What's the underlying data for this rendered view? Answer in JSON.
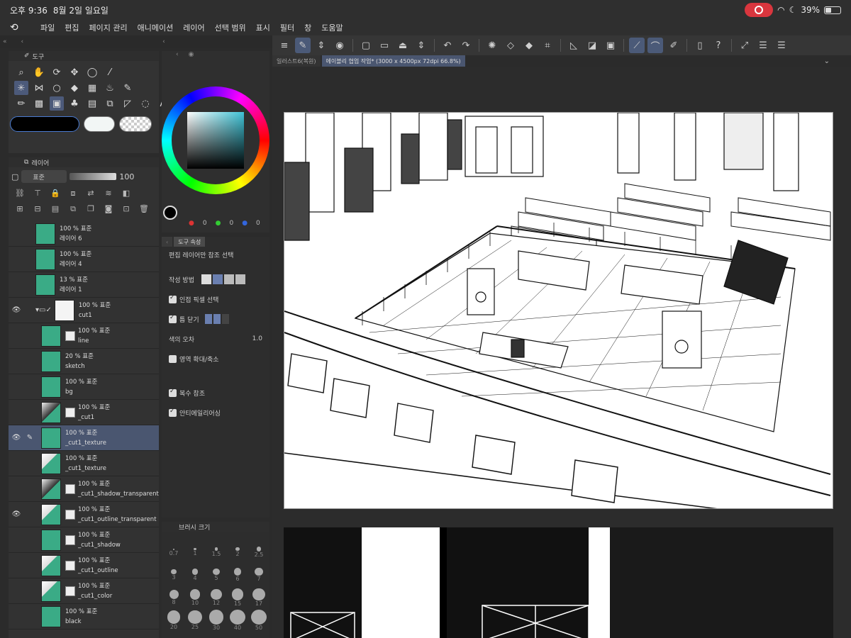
{
  "status_bar": {
    "time": "오후 9:36",
    "date": "8월 2일 일요일",
    "battery": "39%"
  },
  "menu": [
    "파일",
    "편집",
    "페이지 관리",
    "애니메이션",
    "레이어",
    "선택 범위",
    "표시",
    "필터",
    "창",
    "도움말"
  ],
  "tabs": [
    {
      "label": "일러스트6(복원)"
    },
    {
      "label": "에이블리 협업 작업* (3000 x 4500px 72dpi 66.8%)"
    }
  ],
  "tool_panel": {
    "title": "도구"
  },
  "layer_panel": {
    "title": "레이어",
    "blend_mode": "표준",
    "opacity": "100"
  },
  "layers": [
    {
      "opacity": "100 % 표준",
      "name": "레이어 6",
      "eye": "",
      "pen": "",
      "thumb": "green",
      "mask": false,
      "indent": false,
      "selected": false
    },
    {
      "opacity": "100 % 표준",
      "name": "레이어 4",
      "eye": "",
      "pen": "",
      "thumb": "green",
      "mask": false,
      "indent": false,
      "selected": false
    },
    {
      "opacity": "13 % 표준",
      "name": "레이어 1",
      "eye": "",
      "pen": "",
      "thumb": "green",
      "mask": false,
      "indent": false,
      "selected": false
    },
    {
      "opacity": "100 % 표준",
      "name": "cut1",
      "eye": "👁",
      "pen": "",
      "thumb": "white",
      "mask": false,
      "indent": false,
      "selected": false,
      "folder": true
    },
    {
      "opacity": "100 % 표준",
      "name": "line",
      "eye": "",
      "pen": "",
      "thumb": "green",
      "mask": true,
      "indent": true,
      "selected": false
    },
    {
      "opacity": "20 % 표준",
      "name": "sketch",
      "eye": "",
      "pen": "",
      "thumb": "green",
      "mask": false,
      "indent": true,
      "selected": false
    },
    {
      "opacity": "100 % 표준",
      "name": "bg",
      "eye": "",
      "pen": "",
      "thumb": "green",
      "mask": false,
      "indent": true,
      "selected": false
    },
    {
      "opacity": "100 % 표준",
      "name": "_cut1",
      "eye": "",
      "pen": "",
      "thumb": "dark",
      "mask": true,
      "indent": true,
      "selected": false
    },
    {
      "opacity": "100 % 표준",
      "name": "_cut1_texture",
      "eye": "👁",
      "pen": "✎",
      "thumb": "green",
      "mask": false,
      "indent": true,
      "selected": true
    },
    {
      "opacity": "100 % 표준",
      "name": "_cut1_texture",
      "eye": "",
      "pen": "",
      "thumb": "sketch",
      "mask": false,
      "indent": true,
      "selected": false
    },
    {
      "opacity": "100 % 표준",
      "name": "_cut1_shadow_transparent",
      "eye": "",
      "pen": "",
      "thumb": "dark",
      "mask": true,
      "indent": true,
      "selected": false
    },
    {
      "opacity": "100 % 표준",
      "name": "_cut1_outline_transparent",
      "eye": "👁",
      "pen": "",
      "thumb": "sketch",
      "mask": true,
      "indent": true,
      "selected": false
    },
    {
      "opacity": "100 % 표준",
      "name": "_cut1_shadow",
      "eye": "",
      "pen": "",
      "thumb": "green",
      "mask": true,
      "indent": true,
      "selected": false
    },
    {
      "opacity": "100 % 표준",
      "name": "_cut1_outline",
      "eye": "",
      "pen": "",
      "thumb": "sketch",
      "mask": true,
      "indent": true,
      "selected": false
    },
    {
      "opacity": "100 % 표준",
      "name": "_cut1_color",
      "eye": "",
      "pen": "",
      "thumb": "sketch",
      "mask": true,
      "indent": true,
      "selected": false
    },
    {
      "opacity": "100 % 표준",
      "name": "black",
      "eye": "",
      "pen": "",
      "thumb": "green",
      "mask": false,
      "indent": true,
      "selected": false
    }
  ],
  "color_panel": {
    "r": "0",
    "g": "0",
    "b": "0",
    "accent": "#3fc3d6"
  },
  "prop_panel": {
    "tab1": "도구 속성",
    "title": "편집 레이어만 참조 선택",
    "mode_label": "작성 방법",
    "opt_adjacent": "인접 픽셀 선택",
    "opt_close_gap": "틈 닫기",
    "tolerance_label": "색의 오차",
    "tolerance_value": "1.0",
    "opt_expand": "영역 확대/축소",
    "opt_multi_ref": "복수 참조",
    "opt_antialias": "안티에일리어싱"
  },
  "brush_panel": {
    "title": "브러시 크기",
    "sizes": [
      "0.7",
      "1",
      "1.5",
      "2",
      "2.5",
      "3",
      "4",
      "5",
      "6",
      "7",
      "8",
      "10",
      "12",
      "15",
      "17",
      "20",
      "25",
      "30",
      "40",
      "50"
    ]
  }
}
